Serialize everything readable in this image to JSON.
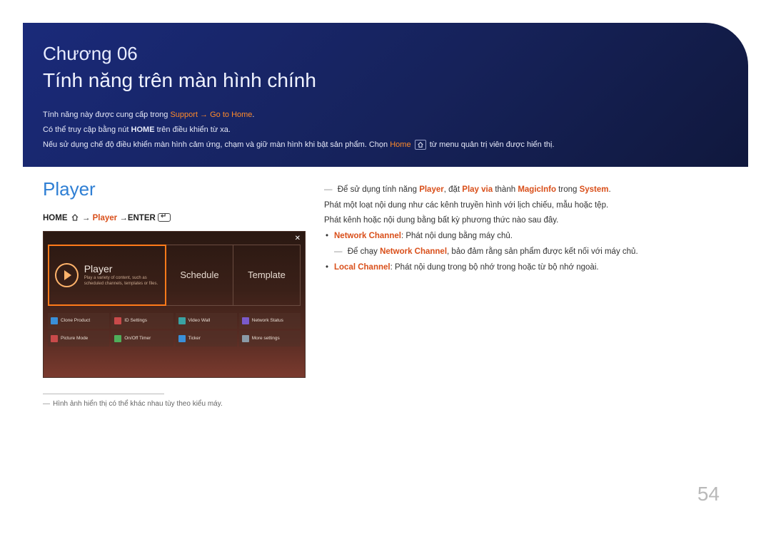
{
  "header": {
    "chapter": "Chương 06",
    "title": "Tính năng trên màn hình chính",
    "line1_pre": "Tính năng này được cung cấp trong ",
    "line1_hl": "Support → Go to Home",
    "line1_post": ".",
    "line2_pre": "Có thể truy cập bằng nút ",
    "line2_bold": "HOME",
    "line2_post": " trên điều khiển từ xa.",
    "line3_pre": "Nếu sử dụng chế độ điều khiển màn hình cảm ứng, chạm và giữ màn hình khi bật sản phẩm. Chọn ",
    "line3_hl": "Home",
    "line3_post": " từ menu quản trị viên được hiển thị."
  },
  "left": {
    "section_title": "Player",
    "nav": {
      "home": "HOME",
      "arrow1": " → ",
      "player": "Player",
      "arrow2": " →",
      "enter": "ENTER"
    },
    "screenshot": {
      "player": "Player",
      "player_sub": "Play a variety of content, such as scheduled channels, templates or files.",
      "schedule": "Schedule",
      "template": "Template",
      "mini": [
        "Clone Product",
        "ID Settings",
        "Video Wall",
        "Network Status",
        "Picture Mode",
        "On/Off Timer",
        "Ticker",
        "More settings"
      ]
    },
    "footnote": "Hình ảnh hiển thị có thể khác nhau tùy theo kiểu máy."
  },
  "right": {
    "l1_pre": "Để sử dụng tính năng ",
    "l1_b1": "Player",
    "l1_mid": ", đặt ",
    "l1_b2": "Play via",
    "l1_mid2": " thành ",
    "l1_b3": "MagicInfo",
    "l1_mid3": " trong ",
    "l1_b4": "System",
    "l1_end": ".",
    "l2": "Phát một loạt nội dung như các kênh truyền hình với lịch chiếu, mẫu hoặc tệp.",
    "l3": "Phát kênh hoặc nội dung bằng bất kỳ phương thức nào sau đây.",
    "b1_label": "Network Channel",
    "b1_text": ": Phát nội dung bằng máy chủ.",
    "b1_note_pre": "Để chạy ",
    "b1_note_b": "Network Channel",
    "b1_note_post": ", bảo đảm rằng sản phẩm được kết nối với máy chủ.",
    "b2_label": "Local Channel",
    "b2_text": ": Phát nội dung trong bộ nhớ trong hoặc từ bộ nhớ ngoài."
  },
  "page_number": "54"
}
